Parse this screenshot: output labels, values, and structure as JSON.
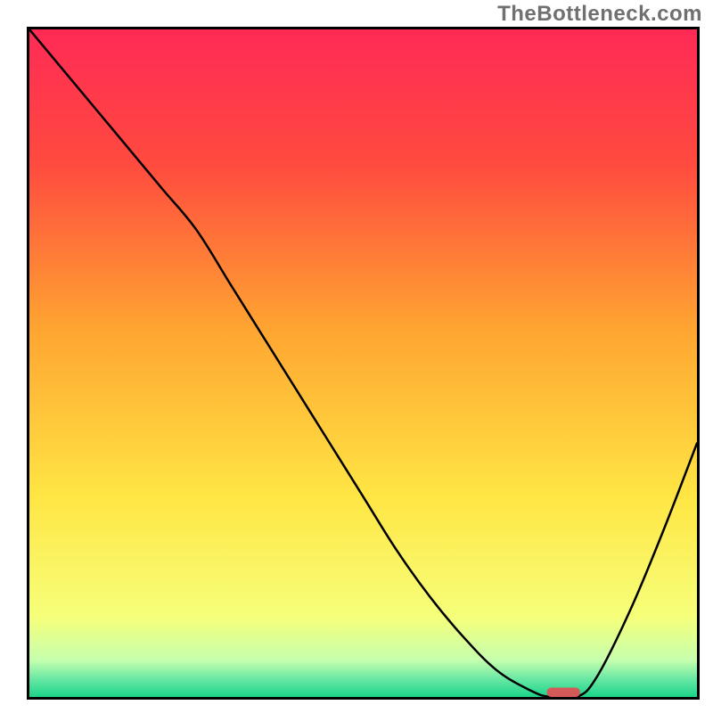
{
  "watermark": "TheBottleneck.com",
  "chart_data": {
    "type": "line",
    "title": "",
    "xlabel": "",
    "ylabel": "",
    "xlim": [
      0,
      100
    ],
    "ylim": [
      0,
      100
    ],
    "grid": false,
    "legend": false,
    "series": [
      {
        "name": "curve",
        "color": "#000000",
        "x": [
          0,
          5,
          10,
          15,
          20,
          25,
          30,
          35,
          40,
          45,
          50,
          55,
          60,
          65,
          70,
          75,
          78,
          82,
          85,
          90,
          95,
          100
        ],
        "values": [
          100,
          94,
          88,
          82,
          76,
          70,
          62,
          54,
          46,
          38,
          30,
          22,
          15,
          9,
          4,
          1,
          0,
          0,
          3,
          13,
          25,
          38
        ]
      }
    ],
    "marker": {
      "name": "optimum-marker",
      "shape": "rounded-rect",
      "color": "#d45a5a",
      "x_center": 80,
      "y": 0,
      "width_units": 5,
      "height_units": 1.4
    },
    "background_gradient": {
      "type": "vertical",
      "stops": [
        {
          "pos": 0.0,
          "color": "#ff2a55"
        },
        {
          "pos": 0.2,
          "color": "#ff4a3f"
        },
        {
          "pos": 0.45,
          "color": "#ffa531"
        },
        {
          "pos": 0.7,
          "color": "#ffe644"
        },
        {
          "pos": 0.88,
          "color": "#f6ff7a"
        },
        {
          "pos": 0.945,
          "color": "#c6ffae"
        },
        {
          "pos": 0.975,
          "color": "#62e6a3"
        },
        {
          "pos": 1.0,
          "color": "#1bd488"
        }
      ]
    }
  }
}
